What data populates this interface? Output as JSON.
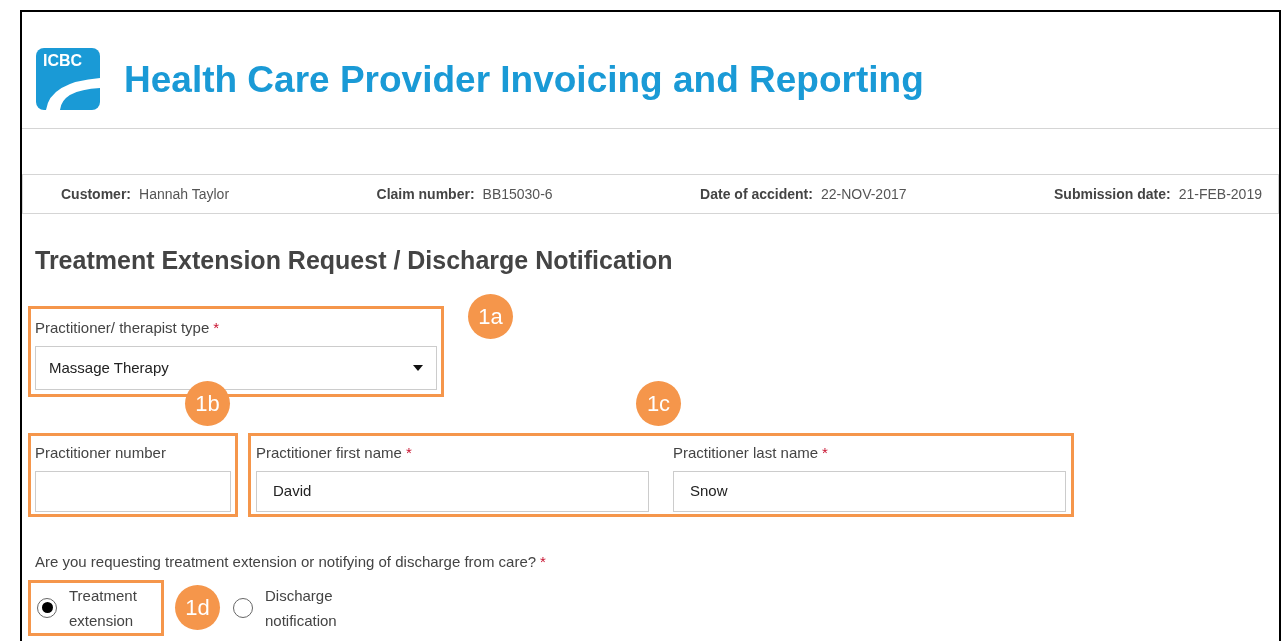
{
  "header": {
    "logo_text": "ICBC",
    "title": "Health Care Provider Invoicing and Reporting"
  },
  "claim_info": [
    {
      "label": "Customer:",
      "value": "Hannah Taylor"
    },
    {
      "label": "Claim number:",
      "value": "BB15030-6"
    },
    {
      "label": "Date of accident:",
      "value": "22-NOV-2017"
    },
    {
      "label": "Submission date:",
      "value": "21-FEB-2019"
    }
  ],
  "heading": "Treatment Extension Request / Discharge Notification",
  "therapist_type": {
    "label": "Practitioner/ therapist type",
    "required_mark": "*",
    "value": "Massage Therapy"
  },
  "practitioner_number": {
    "label": "Practitioner number"
  },
  "name_fields": [
    {
      "label": "Practitioner first name",
      "required_mark": "*",
      "value": "David"
    },
    {
      "label": "Practitioner last name",
      "required_mark": "*",
      "value": "Snow"
    }
  ],
  "question": {
    "label": "Are you requesting treatment extension or notifying of discharge from care?",
    "required_mark": "*"
  },
  "options": [
    {
      "label": "Treatment extension",
      "selected": true
    },
    {
      "label": "Discharge notification",
      "selected": false
    }
  ],
  "callouts": [
    {
      "label": "1a"
    },
    {
      "label": "1b"
    },
    {
      "label": "1c"
    },
    {
      "label": "1d"
    }
  ]
}
